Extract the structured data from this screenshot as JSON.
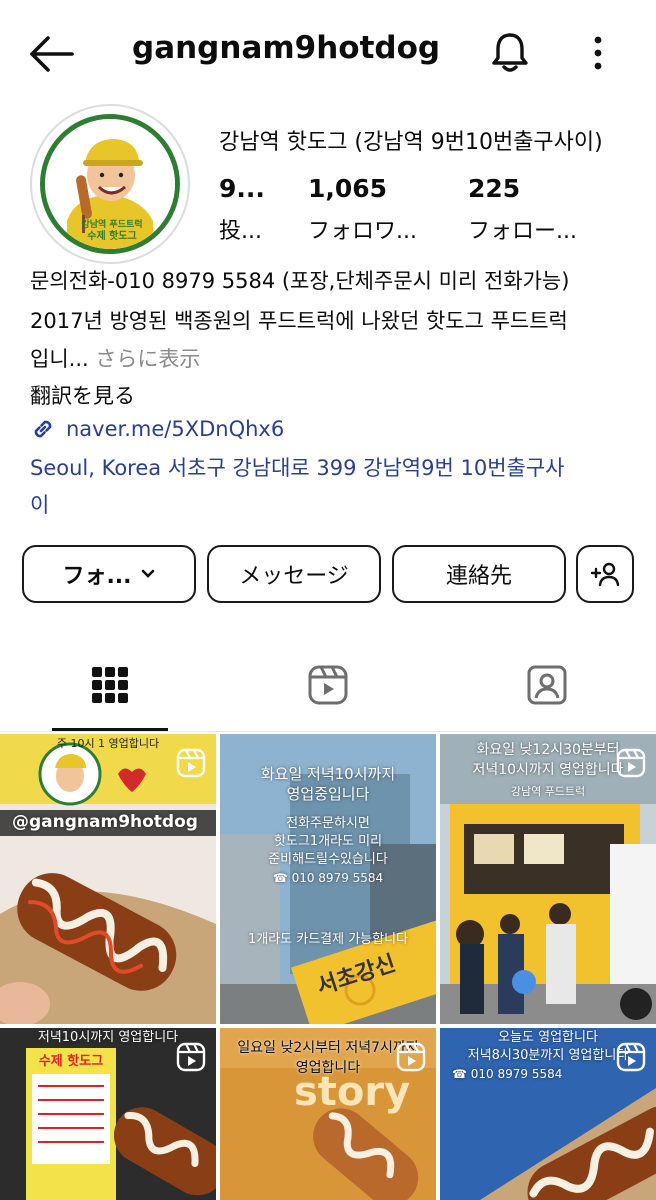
{
  "header": {
    "username": "gangnam9hotdog",
    "icons": {
      "back": "back-arrow-icon",
      "bell": "bell-icon",
      "more": "more-vertical-icon"
    }
  },
  "profile": {
    "display_name": "강남역 핫도그 (강남역 9번10번출구사이)",
    "avatar_text_line1": "강남역 푸드트럭",
    "avatar_text_line2": "수제 핫도그",
    "stats": [
      {
        "value": "9...",
        "label": "投..."
      },
      {
        "value": "1,065",
        "label": "フォロワ..."
      },
      {
        "value": "225",
        "label": "フォロー..."
      }
    ],
    "bio_line1": "문의전화-010 8979 5584 (포장,단체주문시 미리 전화가능)",
    "bio_line2": "2017년 방영된 백종원의 푸드트럭에 나왔던 핫도그 푸드트럭",
    "bio_line3": "입니...",
    "more_label": " さらに表示",
    "translate_label": "翻訳を見る",
    "link": "naver.me/5XDnQhx6",
    "location_line1": "Seoul, Korea 서초구 강남대로 399 강남역9번 10번출구사",
    "location_line2": "이"
  },
  "buttons": {
    "follow": "フォ...",
    "message": "メッセージ",
    "contact": "連絡先",
    "add_user_icon": "add-person-icon"
  },
  "tabs": [
    {
      "name": "grid-icon"
    },
    {
      "name": "reels-icon"
    },
    {
      "name": "tagged-icon"
    }
  ],
  "posts": [
    {
      "handle": "@gangnam9hotdog",
      "top_text": "주 10시 1 영업합니다"
    },
    {
      "text1": "화요일 저녁10시까지",
      "text2": "영업중입니다",
      "text3": "전화주문하시면",
      "text4": "핫도그1개라도 미리",
      "text5": "준비해드릴수있습니다",
      "phone": "☎ 010 8979 5584",
      "text6": "1개라도 카드결제 가능합니다",
      "sign": "서초강신"
    },
    {
      "text1": "화요일 낮12시30분부터",
      "text2": "저녁10시까지 영업합니다",
      "sign": "강남역 푸드트럭"
    },
    {
      "text1": "저녁10시까지 영업합니다",
      "menu_title": "수제 핫도그"
    },
    {
      "text1": "일요일 낮2시부터 저녁7시까지",
      "text2": "영업합니다",
      "sign": "story"
    },
    {
      "text1": "오늘도 영업합니다",
      "text2": "저녁8시30분까지 영업합니다",
      "phone": "☎ 010 8979 5584"
    }
  ],
  "colors": {
    "link": "#2b3f8c",
    "accent_green": "#2e7d32",
    "truck_yellow": "#f2c12e"
  }
}
